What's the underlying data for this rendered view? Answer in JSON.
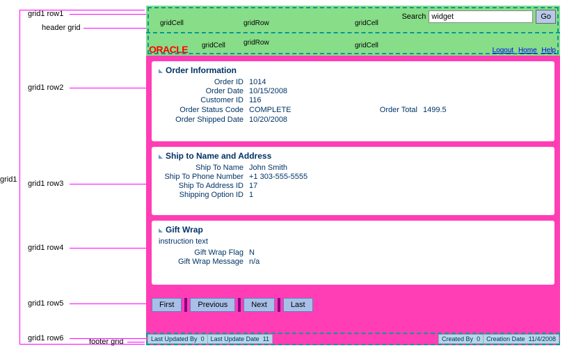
{
  "labels": {
    "grid1": "grid1",
    "row1": "grid1 row1",
    "row2": "grid1 row2",
    "row3": "grid1 row3",
    "row4": "grid1 row4",
    "row5": "grid1 row5",
    "row6": "grid1 row6",
    "header_grid": "header grid",
    "footer_grid": "footer grid"
  },
  "header": {
    "cells": {
      "c1": "gridCell",
      "c2": "gridRow",
      "c3": "gridCell",
      "c4": "gridCell",
      "c5": "gridRow",
      "c6": "gridCell"
    },
    "search_label": "Search",
    "search_value": "widget",
    "go": "Go",
    "brand": "ORACLE",
    "links": {
      "logout": "Logout",
      "home": "Home",
      "help": "Help"
    }
  },
  "order": {
    "title": "Order Information",
    "id_l": "Order ID",
    "id_v": "1014",
    "date_l": "Order Date",
    "date_v": "10/15/2008",
    "cust_l": "Customer ID",
    "cust_v": "116",
    "status_l": "Order Status Code",
    "status_v": "COMPLETE",
    "total_l": "Order Total",
    "total_v": "1499.5",
    "shipped_l": "Order Shipped Date",
    "shipped_v": "10/20/2008"
  },
  "ship": {
    "title": "Ship to Name and Address",
    "name_l": "Ship To Name",
    "name_v": "John Smith",
    "phone_l": "Ship To Phone Number",
    "phone_v": "+1 303-555-5555",
    "addr_l": "Ship To Address ID",
    "addr_v": "17",
    "opt_l": "Shipping Option ID",
    "opt_v": "1"
  },
  "gift": {
    "title": "Gift Wrap",
    "instr": "instruction text",
    "flag_l": "Gift Wrap Flag",
    "flag_v": "N",
    "msg_l": "Gift Wrap Message",
    "msg_v": "n/a"
  },
  "nav": {
    "first": "First",
    "prev": "Previous",
    "next": "Next",
    "last": "Last"
  },
  "footer": {
    "updby_l": "Last Updated By",
    "updby_v": "0",
    "upddate_l": "Last Update Date",
    "upddate_v": "11",
    "crby_l": "Created By",
    "crby_v": "0",
    "crdate_l": "Creation Date",
    "crdate_v": "11/4/2008"
  }
}
